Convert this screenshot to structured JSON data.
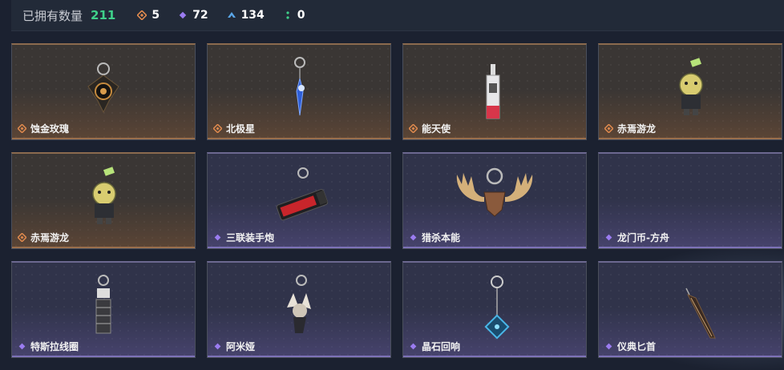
{
  "header": {
    "owned_label": "已拥有数量",
    "owned_count": "211",
    "stats": [
      {
        "icon": "orange-diamond-icon",
        "value": "5",
        "color": "#e08a4e"
      },
      {
        "icon": "purple-diamond-icon",
        "value": "72",
        "color": "#9b7cf0"
      },
      {
        "icon": "blue-arrow-icon",
        "value": "134",
        "color": "#5aa6e8"
      },
      {
        "icon": "green-dots-icon",
        "value": "0",
        "color": "#3fd08a"
      }
    ]
  },
  "items": [
    {
      "name": "蚀金玫瑰",
      "rarity": "orange",
      "icon": "rose-charm-icon"
    },
    {
      "name": "北极星",
      "rarity": "orange",
      "icon": "star-pendant-icon"
    },
    {
      "name": "能天使",
      "rarity": "orange",
      "icon": "card-charm-icon"
    },
    {
      "name": "赤焉游龙",
      "rarity": "orange",
      "icon": "dragon-charm-icon"
    },
    {
      "name": "赤焉游龙",
      "rarity": "orange",
      "icon": "dragon-charm-icon"
    },
    {
      "name": "三联装手炮",
      "rarity": "purple",
      "icon": "cannon-charm-icon"
    },
    {
      "name": "猎杀本能",
      "rarity": "purple",
      "icon": "antler-charm-icon"
    },
    {
      "name": "龙门币-方舟",
      "rarity": "purple",
      "icon": "coin-charm-icon"
    },
    {
      "name": "特斯拉线圈",
      "rarity": "purple",
      "icon": "coil-charm-icon"
    },
    {
      "name": "阿米娅",
      "rarity": "purple",
      "icon": "figure-charm-icon"
    },
    {
      "name": "晶石回响",
      "rarity": "purple",
      "icon": "crystal-charm-icon"
    },
    {
      "name": "仪典匕首",
      "rarity": "purple",
      "icon": "dagger-charm-icon"
    }
  ]
}
